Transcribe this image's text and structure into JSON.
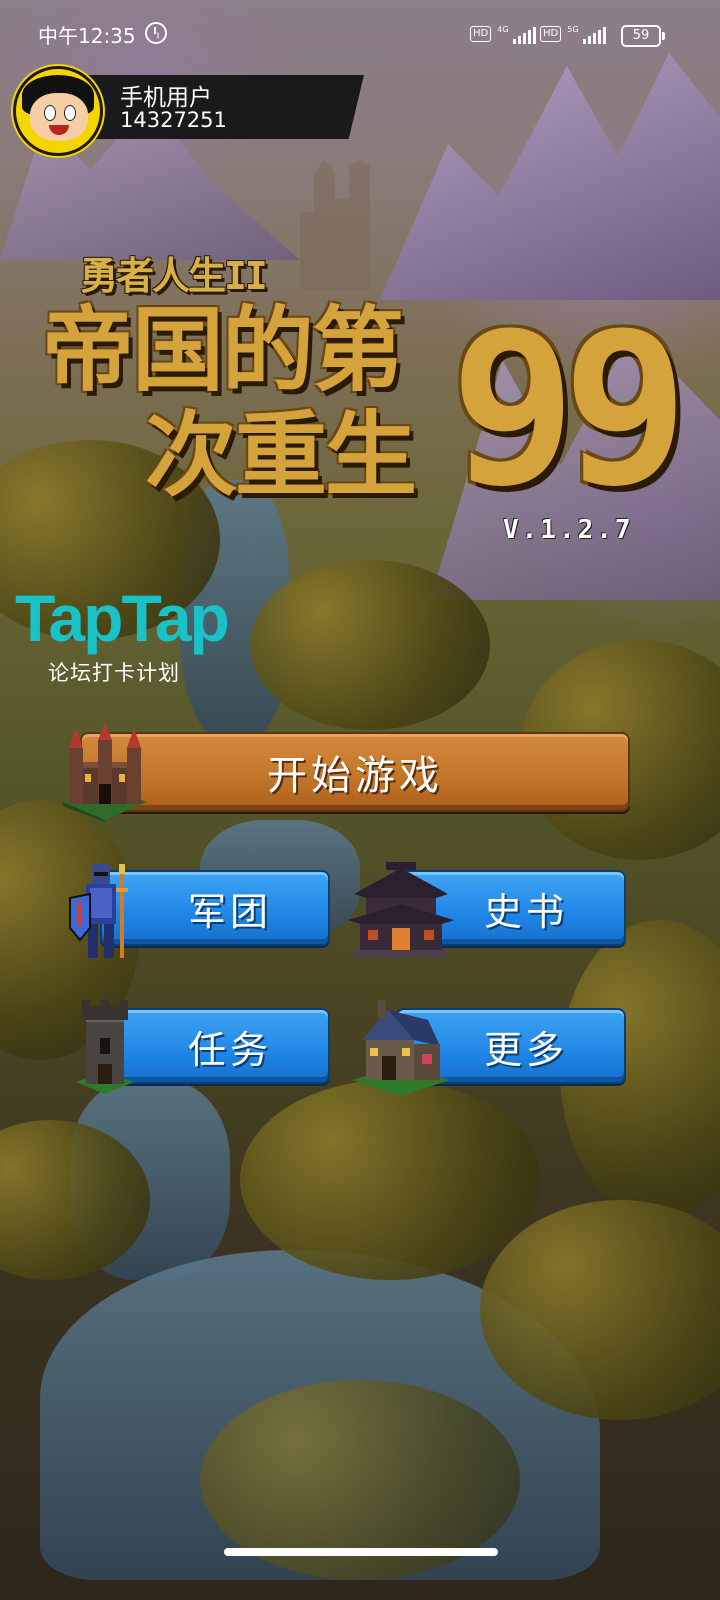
{
  "status_bar": {
    "time": "中午12:35",
    "network_1": "4G",
    "network_2": "5G",
    "hd_label": "HD",
    "battery": "59"
  },
  "user": {
    "name": "手机用户",
    "id": "14327251"
  },
  "title": {
    "small": "勇者人生II",
    "line1": "帝国的第",
    "line2": "次重生",
    "number": "99",
    "version": "V.1.2.7"
  },
  "taptap": {
    "logo": "TapTap",
    "subtitle": "论坛打卡计划"
  },
  "buttons": {
    "start": "开始游戏",
    "army": "军团",
    "history": "史书",
    "quest": "任务",
    "more": "更多"
  },
  "colors": {
    "start_button": "#c27428",
    "menu_button": "#1f86e6",
    "title_gold": "#d4a33c",
    "taptap": "#19c2c6"
  },
  "icons": [
    "castle-icon",
    "knight-icon",
    "temple-icon",
    "tower-icon",
    "house-icon",
    "alarm-icon",
    "battery-icon",
    "signal-icon"
  ]
}
